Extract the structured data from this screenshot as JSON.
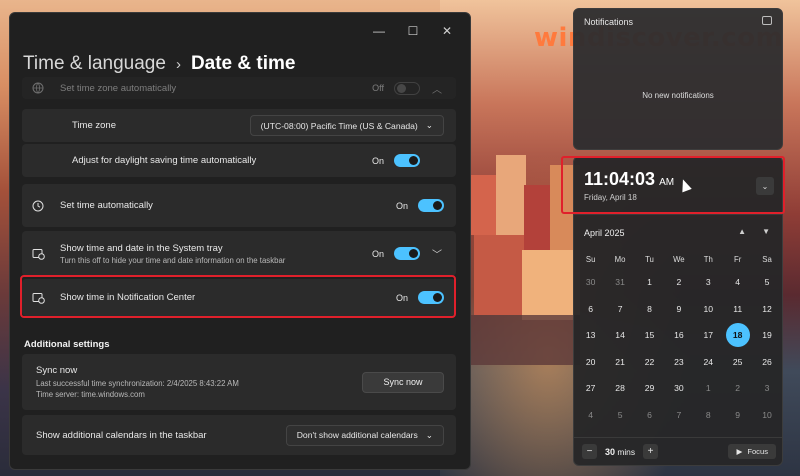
{
  "watermark": "windiscover.com",
  "settings": {
    "breadcrumb_parent": "Time & language",
    "breadcrumb_current": "Date & time",
    "rows": {
      "tz_auto": {
        "label": "Set time zone automatically",
        "state": "Off"
      },
      "timezone": {
        "label": "Time zone",
        "value": "(UTC-08:00) Pacific Time (US & Canada)"
      },
      "dst": {
        "label": "Adjust for daylight saving time automatically",
        "state": "On"
      },
      "time_auto": {
        "label": "Set time automatically",
        "state": "On"
      },
      "tray": {
        "label": "Show time and date in the System tray",
        "sub": "Turn this off to hide your time and date information on the taskbar",
        "state": "On"
      },
      "notif_center": {
        "label": "Show time in Notification Center",
        "state": "On"
      }
    },
    "additional_title": "Additional settings",
    "sync": {
      "title": "Sync now",
      "last": "Last successful time synchronization: 2/4/2025 8:43:22 AM",
      "server": "Time server: time.windows.com",
      "button": "Sync now"
    },
    "calendars": {
      "label": "Show additional calendars in the taskbar",
      "value": "Don't show additional calendars"
    }
  },
  "notifications": {
    "title": "Notifications",
    "empty": "No new notifications"
  },
  "calendar": {
    "time": "11:04:03",
    "ampm": "AM",
    "date": "Friday, April 18",
    "month": "April 2025",
    "weekdays": [
      "Su",
      "Mo",
      "Tu",
      "We",
      "Th",
      "Fr",
      "Sa"
    ],
    "days": [
      [
        "30",
        "31",
        "1",
        "2",
        "3",
        "4",
        "5"
      ],
      [
        "6",
        "7",
        "8",
        "9",
        "10",
        "11",
        "12"
      ],
      [
        "13",
        "14",
        "15",
        "16",
        "17",
        "18",
        "19"
      ],
      [
        "20",
        "21",
        "22",
        "23",
        "24",
        "25",
        "26"
      ],
      [
        "27",
        "28",
        "29",
        "30",
        "1",
        "2",
        "3"
      ],
      [
        "4",
        "5",
        "6",
        "7",
        "8",
        "9",
        "10"
      ]
    ],
    "muted_indices": [
      0,
      1,
      32,
      33,
      34,
      35,
      36,
      37,
      38,
      39,
      40,
      41
    ],
    "today_index": 19,
    "focus_minutes": "30",
    "focus_unit": "mins",
    "focus_label": "Focus"
  }
}
